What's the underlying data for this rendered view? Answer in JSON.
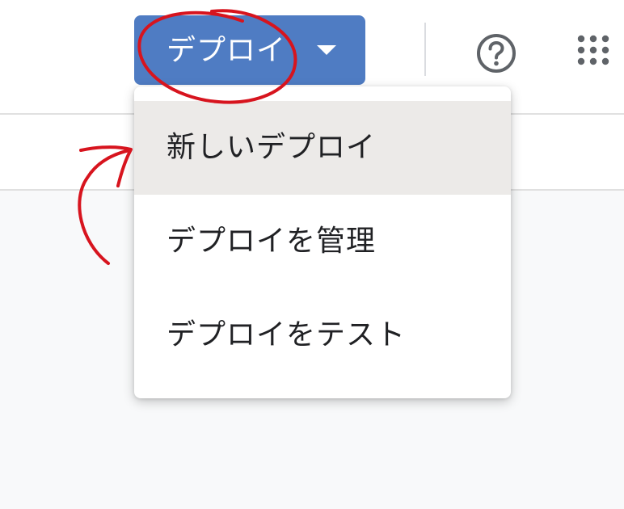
{
  "toolbar": {
    "deploy_label": "デプロイ",
    "help_icon": "help-circle-icon",
    "apps_icon": "apps-grid-icon"
  },
  "deploy_menu": {
    "items": [
      {
        "label": "新しいデプロイ",
        "highlighted": true
      },
      {
        "label": "デプロイを管理"
      },
      {
        "label": "デプロイをテスト"
      }
    ]
  },
  "colors": {
    "deploy_button": "#4f7cc3",
    "annotation": "#d7141e",
    "menu_hover": "#eceae8",
    "text": "#202124",
    "icon": "#5f6368"
  }
}
